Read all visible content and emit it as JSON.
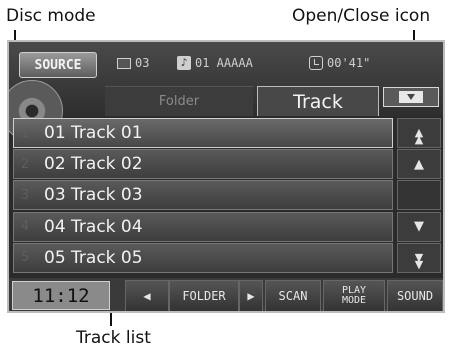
{
  "callouts": {
    "disc_mode": "Disc mode",
    "open_close_icon": "Open/Close icon",
    "track_list": "Track list"
  },
  "header": {
    "source_label": "SOURCE",
    "folder_number": "03",
    "track_info": "01 AAAAA",
    "elapsed_time": "00'41\"",
    "icons": [
      "folder-icon",
      "music-note-icon",
      "clock-icon",
      "eject-icon",
      "disc-icon"
    ]
  },
  "tabs": [
    {
      "label": "Folder",
      "active": false
    },
    {
      "label": "Track",
      "active": true
    }
  ],
  "tracks": [
    {
      "index": "1",
      "name": "01 Track 01"
    },
    {
      "index": "2",
      "name": "02 Track 02"
    },
    {
      "index": "3",
      "name": "03 Track 03"
    },
    {
      "index": "4",
      "name": "04 Track 04"
    },
    {
      "index": "5",
      "name": "05 Track 05"
    }
  ],
  "scroll_buttons": {
    "top": "▲▲",
    "up": "▲",
    "down": "▼",
    "bottom": "▼▼"
  },
  "bottom_bar": {
    "clock": "11:12",
    "prev_folder_glyph": "◀",
    "folder_label": "FOLDER",
    "next_folder_glyph": "▶",
    "scan_label": "SCAN",
    "play_mode_line1": "PLAY",
    "play_mode_line2": "MODE",
    "sound_label": "SOUND"
  }
}
